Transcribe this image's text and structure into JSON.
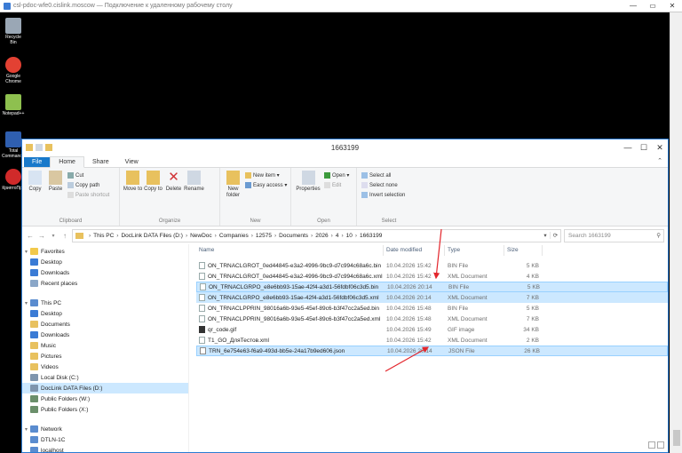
{
  "rdp": {
    "title": "csl-pdoc-wfe0.cislink.moscow — Подключение к удаленному рабочему столу",
    "minimize": "—",
    "maximize": "▭",
    "close": "✕"
  },
  "desktop_icons": [
    {
      "label": "Recycle Bin",
      "icon": "recycle-bin-icon",
      "color": "#9aa7b5"
    },
    {
      "label": "Google Chrome",
      "icon": "chrome-icon",
      "color": "#e34133"
    },
    {
      "label": "Notepad++",
      "icon": "notepad-plus-plus-icon",
      "color": "#8ec04f"
    },
    {
      "label": "Total Commander",
      "icon": "total-commander-icon",
      "color": "#2f5fb0"
    },
    {
      "label": "КриптоПро",
      "icon": "cryptopro-icon",
      "color": "#d02a2a"
    }
  ],
  "window": {
    "title": "1663199",
    "minimize": "—",
    "maximize": "☐",
    "close": "✕"
  },
  "ribbon": {
    "tabs": [
      "File",
      "Home",
      "Share",
      "View"
    ],
    "active_tab": "Home",
    "clipboard": {
      "copy": "Copy",
      "paste": "Paste",
      "cut": "Cut",
      "copy_path": "Copy path",
      "paste_shortcut": "Paste shortcut",
      "group": "Clipboard"
    },
    "organize": {
      "move_to": "Move to",
      "copy_to": "Copy to",
      "delete": "Delete",
      "rename": "Rename",
      "group": "Organize"
    },
    "new": {
      "new_folder": "New folder",
      "new_item": "New item ▾",
      "easy_access": "Easy access ▾",
      "group": "New"
    },
    "open": {
      "properties": "Properties",
      "open": "Open ▾",
      "edit": "Edit",
      "group": "Open"
    },
    "select": {
      "select_all": "Select all",
      "select_none": "Select none",
      "invert_selection": "Invert selection",
      "group": "Select"
    }
  },
  "address": {
    "crumbs": [
      "This PC",
      "DocLink DATA Files (D:)",
      "NewDoc",
      "Companies",
      "12575",
      "Documents",
      "2026",
      "4",
      "10",
      "1663199"
    ],
    "separator": "›",
    "search_placeholder": "Search 1663199"
  },
  "navpane": {
    "favorites": "Favorites",
    "favorites_items": [
      "Desktop",
      "Downloads",
      "Recent places"
    ],
    "this_pc": "This PC",
    "this_pc_items": [
      "Desktop",
      "Documents",
      "Downloads",
      "Music",
      "Pictures",
      "Videos",
      "Local Disk (C:)",
      "DocLink DATA Files (D:)",
      "Public Folders (W:)",
      "Public Folders (X:)"
    ],
    "network": "Network",
    "network_items": [
      "DTLN-1C",
      "localhost"
    ]
  },
  "columns": {
    "name": "Name",
    "date": "Date modified",
    "type": "Type",
    "size": "Size"
  },
  "files": [
    {
      "name": "ON_TRNACLGROT_0ed44845-e3a2-4996-9bc9-d7c994c68a6c.bin",
      "date": "10.04.2026 15:42",
      "type": "BIN File",
      "size": "5 KB",
      "kind": "bin"
    },
    {
      "name": "ON_TRNACLGROT_0ed44845-e3a2-4996-9bc9-d7c994c68a6c.xml",
      "date": "10.04.2026 15:42",
      "type": "XML Document",
      "size": "4 KB",
      "kind": "xml"
    },
    {
      "name": "ON_TRNACLGRPO_e8e6bb93-15ae-42f4-a3d1-56fdbf06c3d5.bin",
      "date": "10.04.2026 20:14",
      "type": "BIN File",
      "size": "5 KB",
      "kind": "bin"
    },
    {
      "name": "ON_TRNACLGRPO_e8e6bb93-15ae-42f4-a3d1-56fdbf06c3d5.xml",
      "date": "10.04.2026 20:14",
      "type": "XML Document",
      "size": "7 KB",
      "kind": "xml"
    },
    {
      "name": "ON_TRNACLPPRIN_98016a6b-93e5-45ef-89c6-b3f47cc2a5ed.bin",
      "date": "10.04.2026 15:48",
      "type": "BIN File",
      "size": "5 KB",
      "kind": "bin"
    },
    {
      "name": "ON_TRNACLPPRIN_98016a6b-93e5-45ef-89c6-b3f47cc2a5ed.xml",
      "date": "10.04.2026 15:48",
      "type": "XML Document",
      "size": "7 KB",
      "kind": "xml"
    },
    {
      "name": "qr_code.gif",
      "date": "10.04.2026 15:49",
      "type": "GIF image",
      "size": "34 KB",
      "kind": "gif"
    },
    {
      "name": "T1_GO_ДляТестов.xml",
      "date": "10.04.2026 15:42",
      "type": "XML Document",
      "size": "2 KB",
      "kind": "xml"
    },
    {
      "name": "TRN_6e754e63-f6a9-493d-bb5e-24a17b9ed606.json",
      "date": "10.04.2026 20:14",
      "type": "JSON File",
      "size": "26 KB",
      "kind": "json"
    }
  ],
  "accent_colors": {
    "arrow": "#e3262c",
    "selection": "#cce8ff",
    "file_tab": "#1979ca"
  }
}
